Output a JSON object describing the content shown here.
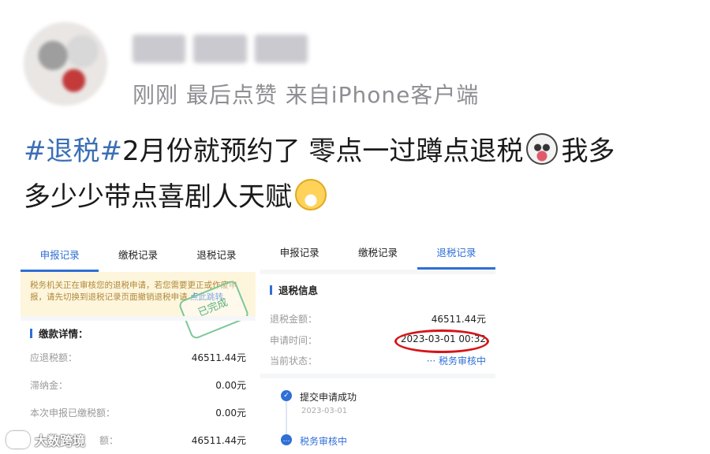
{
  "post": {
    "meta": "刚刚  最后点赞  来自iPhone客户端",
    "hashtag": "#退税#",
    "text_line1": "2月份就预约了 零点一过蹲点退税",
    "text_line1_tail": "我多",
    "text_line2": "多少少带点喜剧人天赋"
  },
  "screenshot_left": {
    "tabs": [
      "申报记录",
      "缴税记录",
      "退税记录"
    ],
    "active_tab": 0,
    "notice": "税务机关正在审核您的退税申请，若您需要更正或作废申报，请先切换到退税记录页面撤销退税申请",
    "notice_link": "点此跳转",
    "stamp": "已完成",
    "section_title": "缴款详情：",
    "rows": [
      {
        "label": "应退税额：",
        "value": "46511.44元"
      },
      {
        "label": "滞纳金：",
        "value": "0.00元"
      },
      {
        "label": "本次申报已缴税额：",
        "value": "0.00元"
      },
      {
        "label": "额：",
        "value": "46511.44元"
      }
    ]
  },
  "screenshot_right": {
    "tabs": [
      "申报记录",
      "缴税记录",
      "退税记录"
    ],
    "active_tab": 2,
    "section_title": "退税信息",
    "rows": [
      {
        "label": "退税金额：",
        "value": "46511.44元"
      },
      {
        "label": "申请时间：",
        "value": "2023-03-01 00:32"
      },
      {
        "label": "当前状态：",
        "value": "··· 税务审核中"
      }
    ],
    "timeline": [
      {
        "label": "提交申请成功",
        "date": "2023-03-01"
      },
      {
        "label": "税务审核中",
        "date": ""
      }
    ]
  },
  "watermark": "大数跨境"
}
